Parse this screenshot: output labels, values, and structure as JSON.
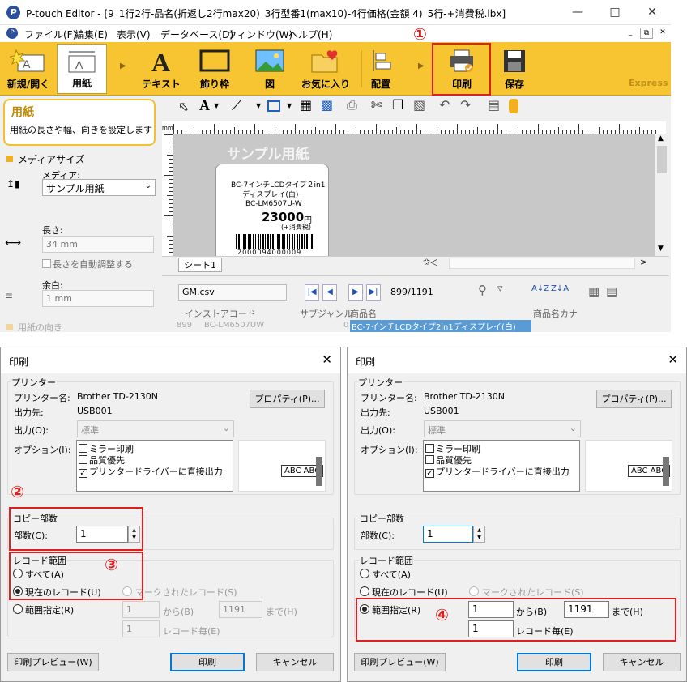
{
  "app": {
    "title": "P-touch Editor - [9_1行2行-品名(折返し2行max20)_3行型番1(max10)-4行価格(金額 4)_5行-+消費税.lbx]",
    "menu": [
      "ファイル(F)",
      "編集(E)",
      "表示(V)",
      "データベース(D)",
      "ウィンドウ(W)",
      "ヘルプ(H)"
    ],
    "ribbon": {
      "open": "新規/開く",
      "paper": "用紙",
      "text": "テキスト",
      "frame": "飾り枠",
      "image": "図",
      "favorites": "お気に入り",
      "layout": "配置",
      "print": "印刷",
      "save": "保存",
      "express": "Express"
    },
    "markers": {
      "m1": "①",
      "m2": "②",
      "m3": "③",
      "m4": "④"
    },
    "leftpanel": {
      "tip_title": "用紙",
      "tip_desc": "用紙の長さや幅、向きを設定します",
      "media_size": "メディアサイズ",
      "media_label": "メディア:",
      "media_value": "サンプル用紙",
      "length_label": "長さ:",
      "length_value": "34 mm",
      "auto_length": "長さを自動調整する",
      "margin_label": "余白:",
      "margin_value": "1 mm",
      "orientation": "用紙の向き"
    },
    "canvas": {
      "mm": "mm",
      "paper_name": "サンプル用紙",
      "sheet": "シート1",
      "product1": "BC-7インチLCDタイプ２in1",
      "product2": "ディスプレイ(白)",
      "model": "BC-LM6507U-W",
      "price": "23000",
      "yen": "円",
      "tax": "(+消費税)",
      "barcode_num": "2000094000009"
    },
    "datapanel": {
      "file": "GM.csv",
      "record": "899/1191",
      "col1": "インストアコード",
      "col2": "サブジャンル",
      "col3": "商品名",
      "col4": "商品名カナ",
      "row_num": "899",
      "row_code": "BC-LM6507UW",
      "row_sub": "0",
      "row_name": "BC-7インチLCDタイプ2in1ディスプレイ(白)"
    }
  },
  "dialog_left": {
    "title": "印刷",
    "printer_group": "プリンター",
    "printer_name_label": "プリンター名:",
    "printer_name": "Brother TD-2130N",
    "port_label": "出力先:",
    "port": "USB001",
    "properties": "プロパティ(P)...",
    "output_label": "出力(O):",
    "output_value": "標準",
    "options_label": "オプション(I):",
    "options": [
      "ミラー印刷",
      "品質優先",
      "プリンタードライバーに直接出力"
    ],
    "preview_text": "ABC ABC",
    "copies_group": "コピー部数",
    "copies_label": "部数(C):",
    "copies_value": "1",
    "range_group": "レコード範囲",
    "all": "すべて(A)",
    "current": "現在のレコード(U)",
    "marked": "マークされたレコード(S)",
    "range": "範囲指定(R)",
    "from_value": "1",
    "from_label": "から(B)",
    "to_value": "1191",
    "to_label": "まで(H)",
    "every_value": "1",
    "every_label": "レコード毎(E)",
    "preview_btn": "印刷プレビュー(W)",
    "print_btn": "印刷",
    "cancel_btn": "キャンセル"
  },
  "dialog_right": {
    "copies_value": "1",
    "from_value": "1",
    "to_value": "1191",
    "every_value": "1"
  }
}
